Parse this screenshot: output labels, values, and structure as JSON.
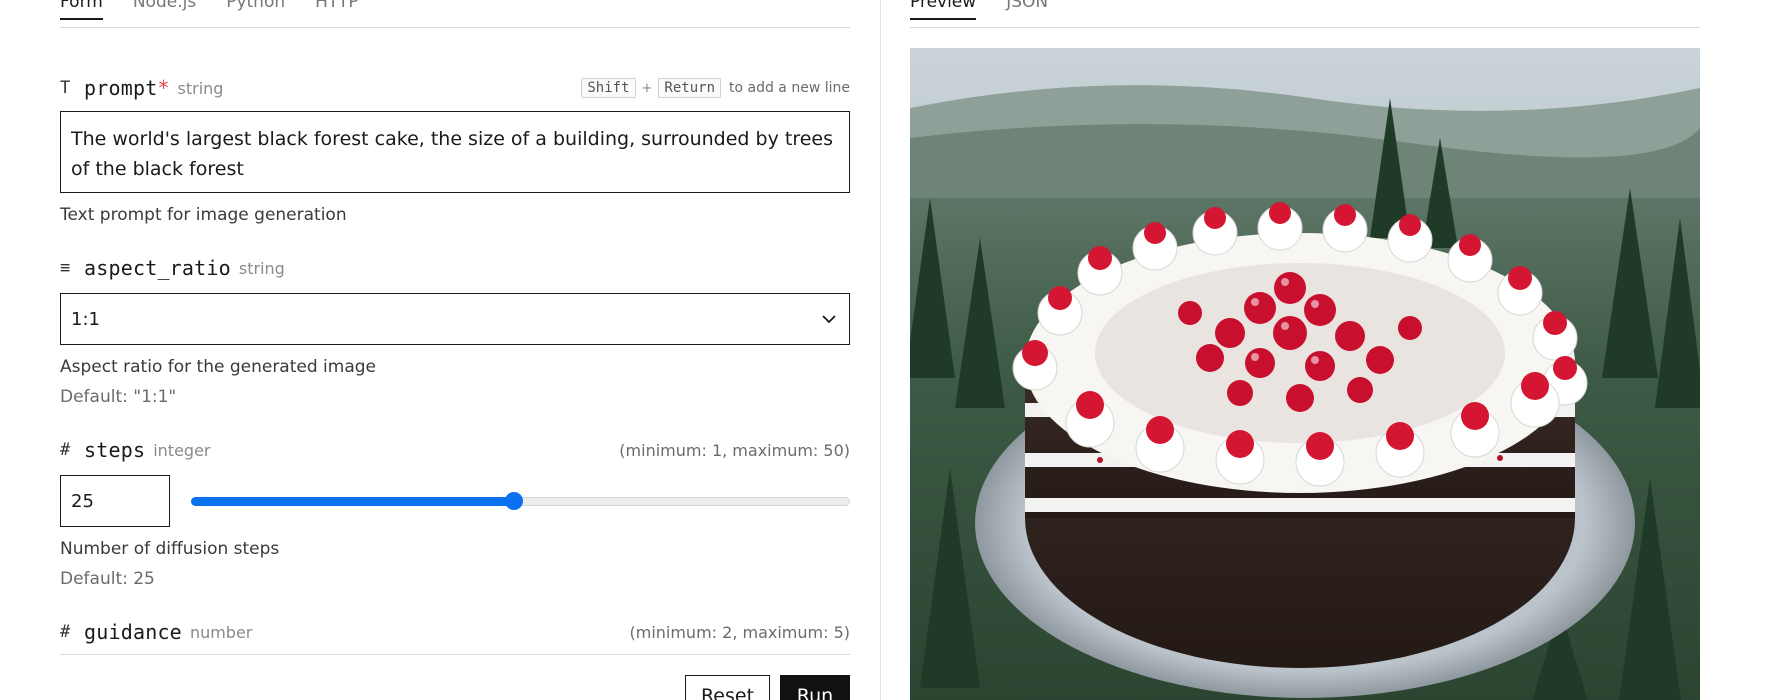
{
  "left_tabs": [
    {
      "label": "Form",
      "active": true
    },
    {
      "label": "Node.js",
      "active": false
    },
    {
      "label": "Python",
      "active": false
    },
    {
      "label": "HTTP",
      "active": false
    }
  ],
  "right_tabs": [
    {
      "label": "Preview",
      "active": true
    },
    {
      "label": "JSON",
      "active": false
    }
  ],
  "fields": {
    "prompt": {
      "icon": "T",
      "name": "prompt",
      "required_mark": "*",
      "type": "string",
      "shortcut_key1": "Shift",
      "shortcut_plus": "+",
      "shortcut_key2": "Return",
      "shortcut_hint": "to add a new line",
      "value": "The world's largest black forest cake, the size of a building, surrounded by trees of the black forest",
      "description": "Text prompt for image generation"
    },
    "aspect_ratio": {
      "icon": "≡",
      "name": "aspect_ratio",
      "type": "string",
      "value": "1:1",
      "description": "Aspect ratio for the generated image",
      "default_text": "Default: \"1:1\""
    },
    "steps": {
      "icon": "#",
      "name": "steps",
      "type": "integer",
      "range_text": "(minimum: 1, maximum: 50)",
      "value": "25",
      "min": 1,
      "max": 50,
      "description": "Number of diffusion steps",
      "default_text": "Default: 25"
    },
    "guidance": {
      "icon": "#",
      "name": "guidance",
      "type": "number",
      "range_text": "(minimum: 2, maximum: 5)"
    }
  },
  "buttons": {
    "reset_label": "Reset",
    "run_label": "Run"
  },
  "colors": {
    "accent": "#0a72ee",
    "required": "#e5484d",
    "text": "#1a1a1a"
  }
}
